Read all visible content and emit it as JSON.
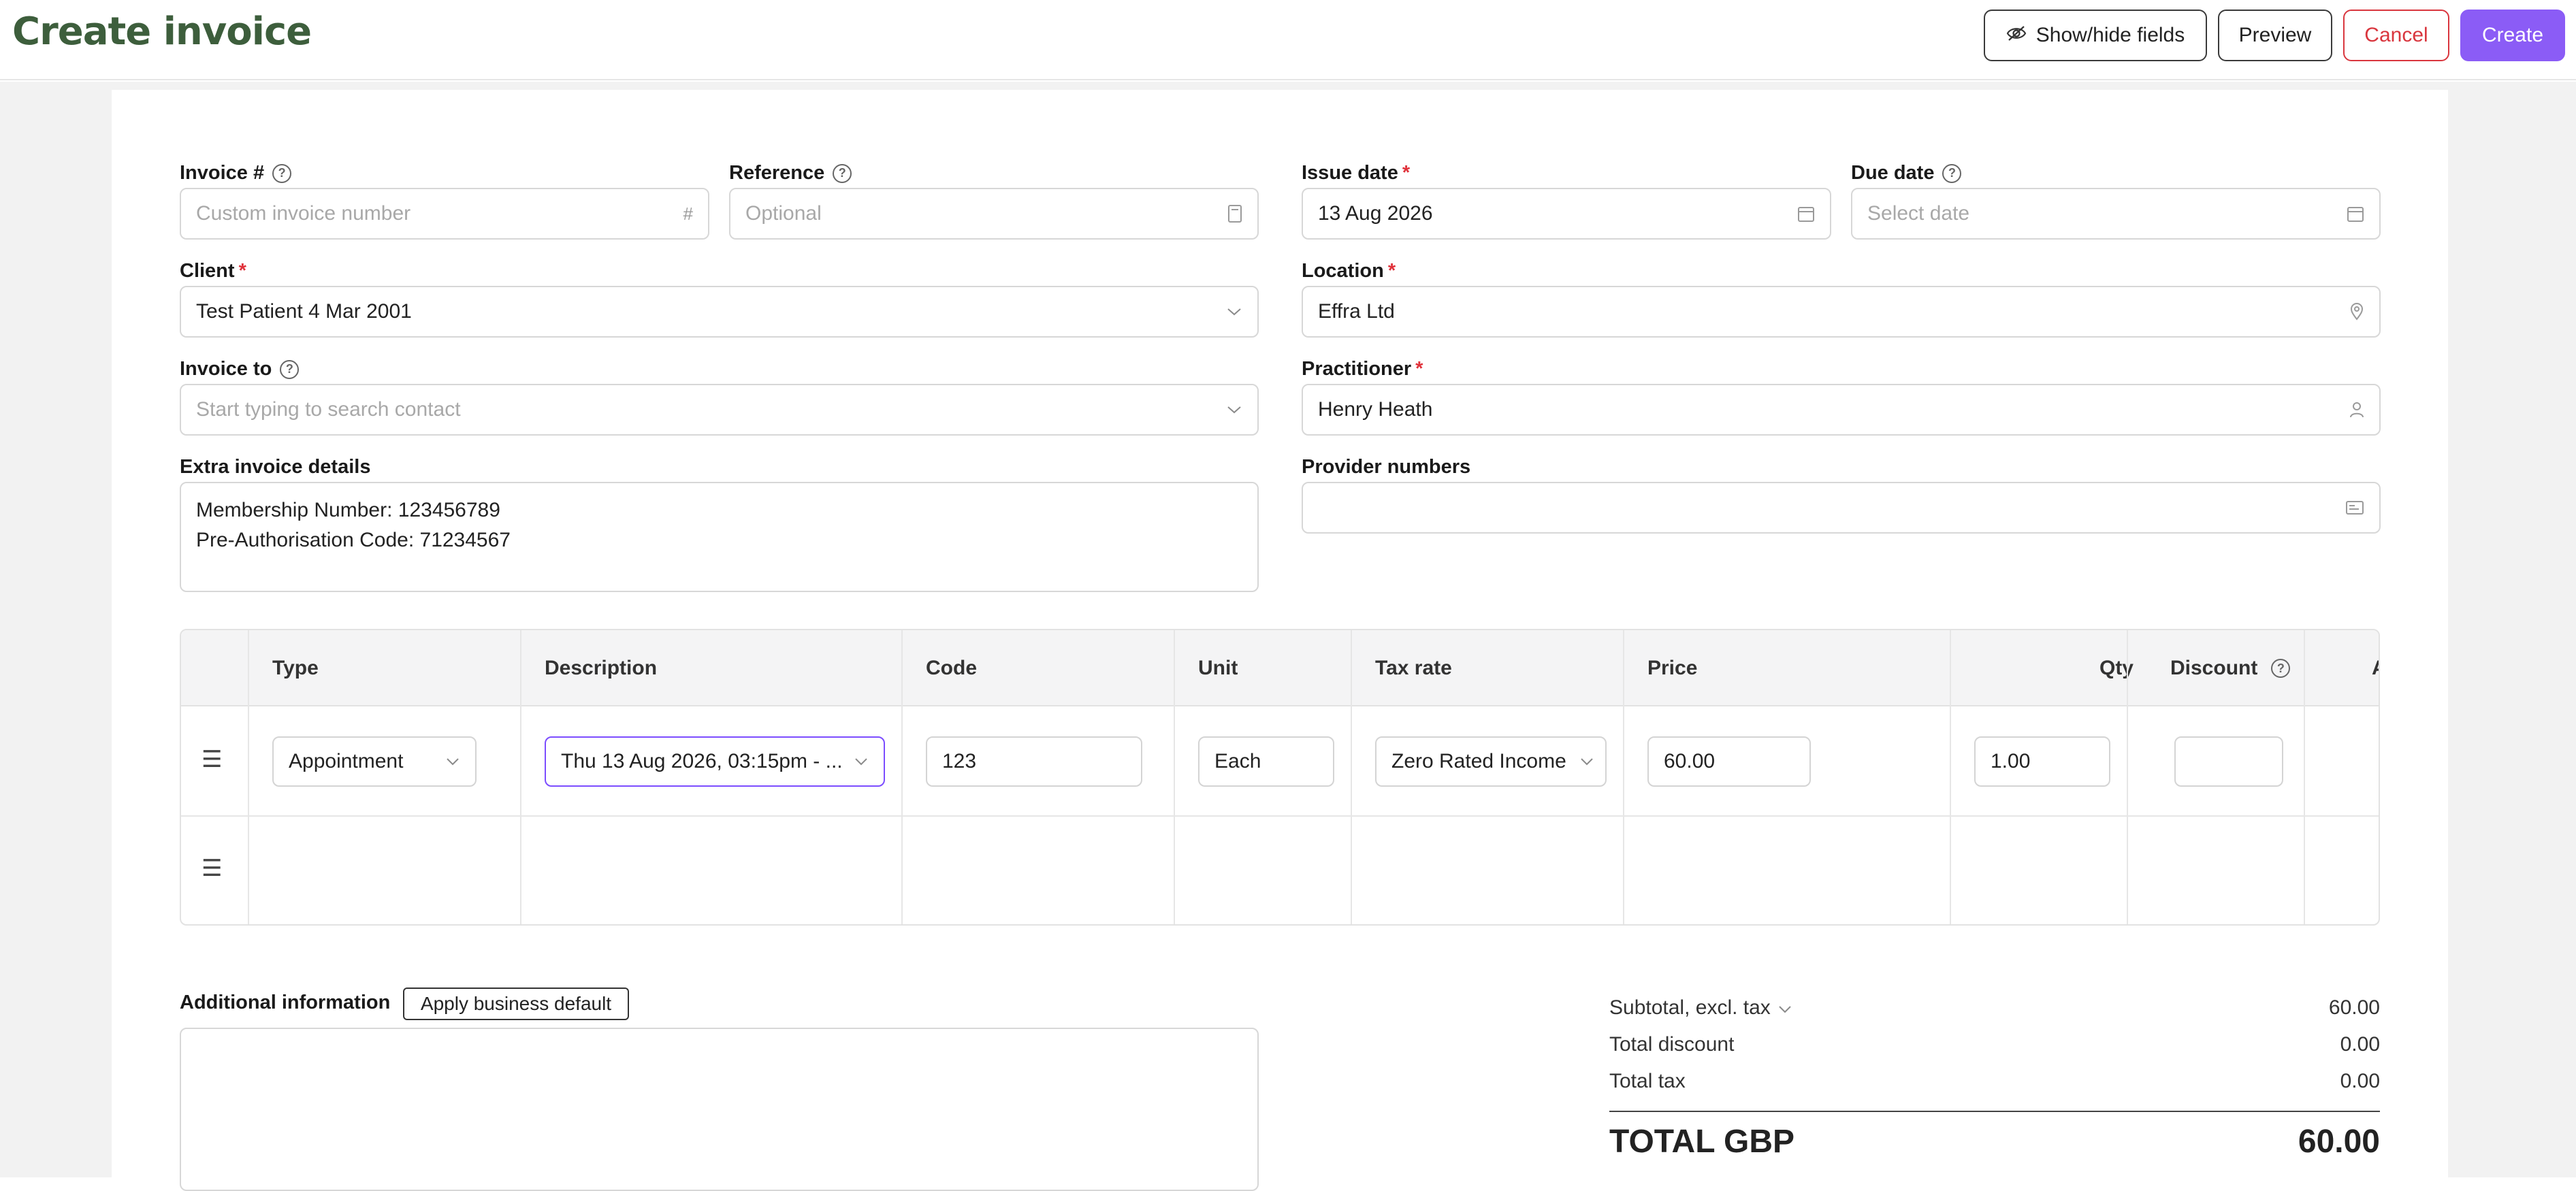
{
  "header": {
    "title": "Create invoice",
    "show_hide_label": "Show/hide fields",
    "preview_label": "Preview",
    "cancel_label": "Cancel",
    "create_label": "Create"
  },
  "form": {
    "invoice_number": {
      "label": "Invoice #",
      "placeholder": "Custom invoice number",
      "icon": "hash-icon"
    },
    "reference": {
      "label": "Reference",
      "placeholder": "Optional",
      "icon": "document-icon"
    },
    "issue_date": {
      "label": "Issue date",
      "required": "*",
      "value": "13 Aug 2026",
      "icon": "calendar-icon"
    },
    "due_date": {
      "label": "Due date",
      "placeholder": "Select date",
      "icon": "calendar-icon"
    },
    "client": {
      "label": "Client",
      "required": "*",
      "value": "Test Patient 4 Mar 2001"
    },
    "location": {
      "label": "Location",
      "required": "*",
      "value": "Effra Ltd",
      "icon": "location-pin-icon"
    },
    "invoice_to": {
      "label": "Invoice to",
      "placeholder": "Start typing to search contact"
    },
    "practitioner": {
      "label": "Practitioner",
      "required": "*",
      "value": "Henry Heath",
      "icon": "person-icon"
    },
    "extra_details": {
      "label": "Extra invoice details",
      "line1": "Membership Number: 123456789",
      "line2": "Pre-Authorisation Code: 71234567"
    },
    "provider_numbers": {
      "label": "Provider numbers",
      "value": "",
      "icon": "id-card-icon"
    }
  },
  "table": {
    "columns": [
      "Type",
      "Description",
      "Code",
      "Unit",
      "Tax rate",
      "Price",
      "Qty",
      "Discount",
      "A"
    ],
    "rows": [
      {
        "type": "Appointment",
        "description": "Thu 13 Aug 2026, 03:15pm - ...",
        "code": "123",
        "unit": "Each",
        "tax_rate": "Zero Rated Income",
        "price": "60.00",
        "qty": "1.00",
        "discount": ""
      }
    ]
  },
  "additional": {
    "label": "Additional information",
    "apply_default_label": "Apply business default"
  },
  "totals": {
    "subtotal_label": "Subtotal, excl. tax",
    "subtotal_value": "60.00",
    "discount_label": "Total discount",
    "discount_value": "0.00",
    "tax_label": "Total tax",
    "tax_value": "0.00",
    "total_label": "TOTAL GBP",
    "total_value": "60.00"
  },
  "colors": {
    "title_green": "#3d5e3c",
    "accent_purple": "#8b5cf6",
    "cancel_red": "#d9363e",
    "required_red": "#e0313a"
  }
}
